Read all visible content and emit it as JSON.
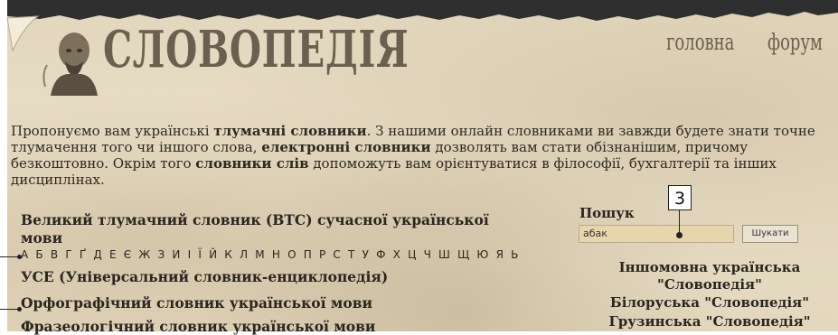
{
  "header": {
    "logo_text": "СЛОВОПЕДІЯ",
    "nav": {
      "home": "головна",
      "forum": "форум"
    }
  },
  "intro": {
    "p1": "Пропонуємо вам українські ",
    "b1": "тлумачні словники",
    "p2": ". З нашими онлайн словниками ви завжди будете знати точне тлумачення того чи іншого слова, ",
    "b2": "електронні словники",
    "p3": " дозволять вам стати обізнанішим, причому безкоштовно. Окрім того ",
    "b3": "словники слів",
    "p4": " допоможуть вам орієнтуватися в філософії, бухгалтерії та інших дисциплінах."
  },
  "dictionaries": {
    "vts_line1": "Великий тлумачний словник (ВТС) сучасної української",
    "vts_line2": "мови",
    "alphabet": "А Б В Г Ґ Д Е Є Ж З И І Ї Й К Л М Н О П Р С Т У Ф Х Ц Ч Ш Щ Ю Я Ь",
    "use": "УСЕ (Універсальний словник-енциклопедія)",
    "orpho": "Орфографічний словник української мови",
    "phraseo": "Фразеологічний словник української мови"
  },
  "search": {
    "label": "Пошук",
    "value": "абак",
    "button": "Шукати"
  },
  "callout": "3",
  "right_links": {
    "foreign_line1": "Іншомовна українська",
    "foreign_line2": "\"Словопедія\"",
    "belarus": "Білоруська \"Словопедія\"",
    "georgian": "Грузинська \"Словопедія\""
  },
  "colors": {
    "parchment": "#e5dac1",
    "logo": "#6b6050",
    "search_field": "#e7d5ac"
  }
}
